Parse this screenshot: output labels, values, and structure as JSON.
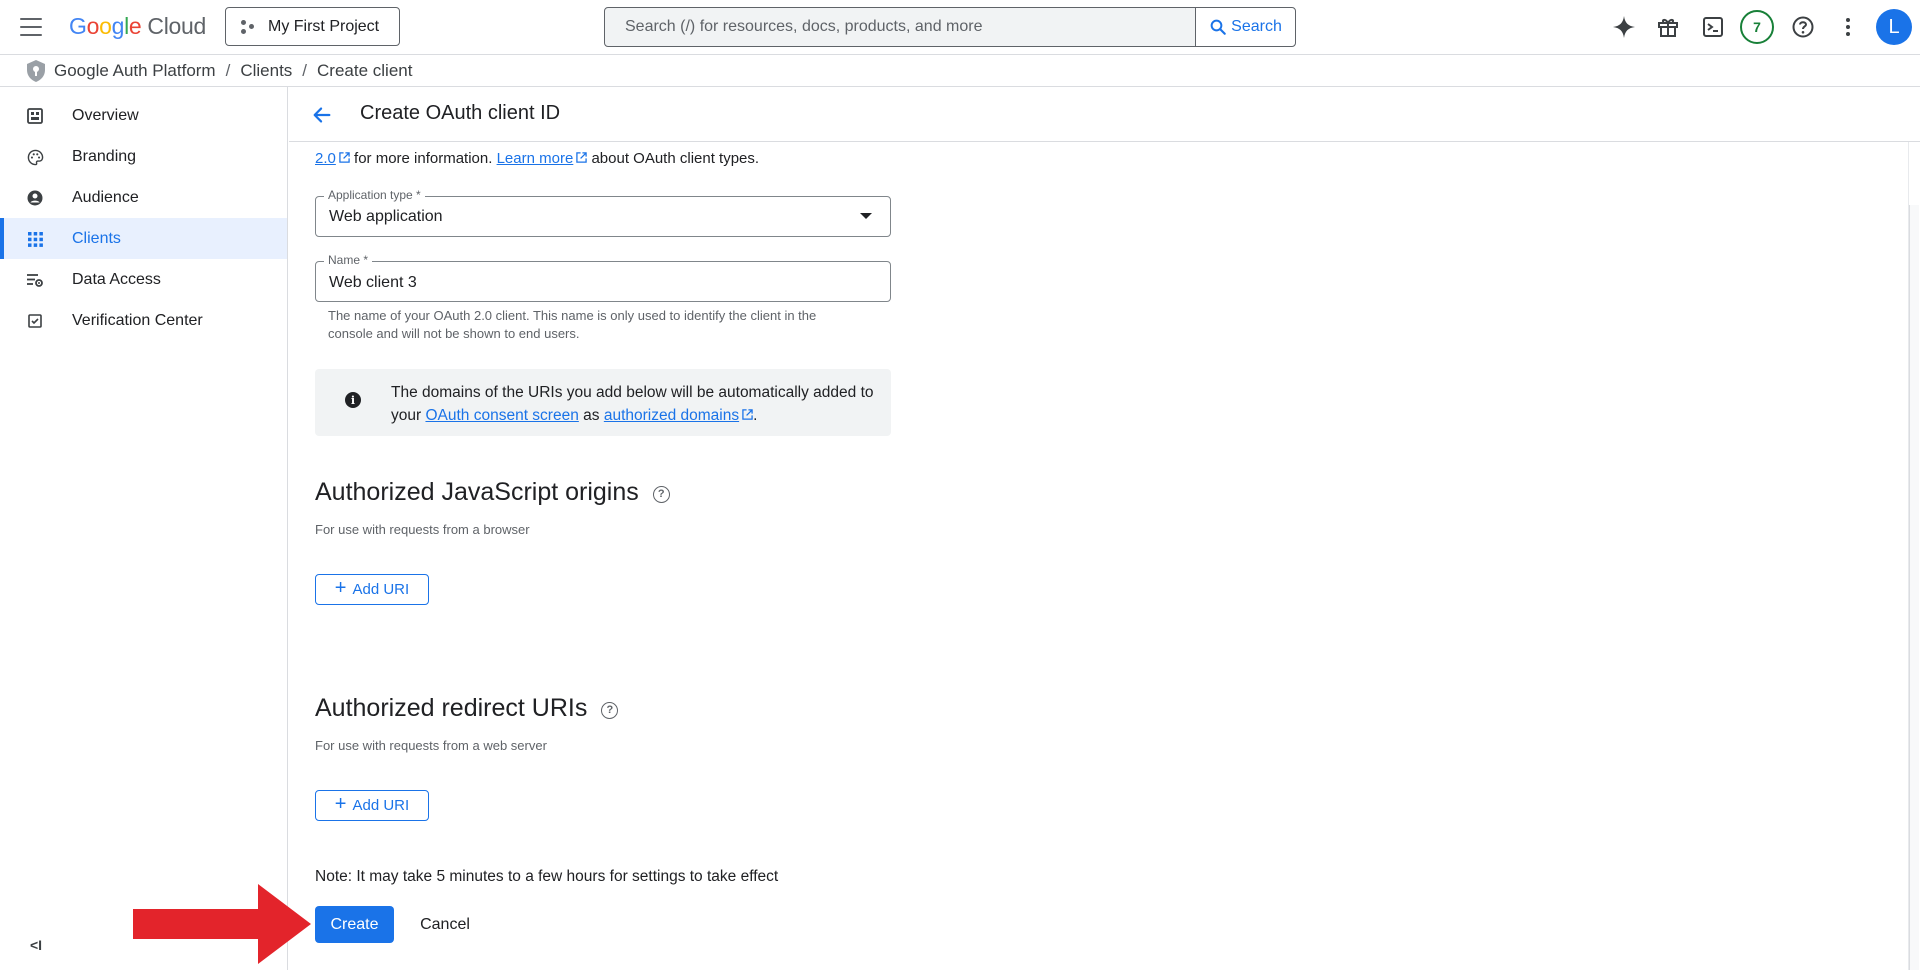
{
  "topbar": {
    "logo_letters": [
      "G",
      "o",
      "o",
      "g",
      "l",
      "e"
    ],
    "logo_cloud": "Cloud",
    "project_name": "My First Project",
    "search_placeholder": "Search (/) for resources, docs, products, and more",
    "search_button": "Search",
    "notifications_count": "7",
    "avatar_initial": "L"
  },
  "breadcrumb": {
    "items": [
      "Google Auth Platform",
      "Clients",
      "Create client"
    ],
    "separator": "/"
  },
  "sidebar": {
    "items": [
      {
        "label": "Overview",
        "icon": "dashboard-icon",
        "active": false
      },
      {
        "label": "Branding",
        "icon": "palette-icon",
        "active": false
      },
      {
        "label": "Audience",
        "icon": "person-icon",
        "active": false
      },
      {
        "label": "Clients",
        "icon": "grid-icon",
        "active": true
      },
      {
        "label": "Data Access",
        "icon": "filter-settings-icon",
        "active": false
      },
      {
        "label": "Verification Center",
        "icon": "checkbox-icon",
        "active": false
      }
    ],
    "collapse_label": "<I"
  },
  "header": {
    "title": "Create OAuth client ID"
  },
  "form": {
    "intro": {
      "link1": "2.0",
      "text1": " for more information. ",
      "link2": "Learn more",
      "text2": " about OAuth client types."
    },
    "application_type": {
      "label": "Application type *",
      "value": "Web application"
    },
    "name": {
      "label": "Name *",
      "value": "Web client 3",
      "hint": "The name of your OAuth 2.0 client. This name is only used to identify the client in the console and will not be shown to end users."
    },
    "info": {
      "text1": "The domains of the URIs you add below will be automatically added to your ",
      "link1": "OAuth consent screen",
      "text2": " as ",
      "link2": "authorized domains",
      "text3": "."
    },
    "js_origins": {
      "title": "Authorized JavaScript origins",
      "subtitle": "For use with requests from a browser",
      "add_label": "Add URI"
    },
    "redirect_uris": {
      "title": "Authorized redirect URIs",
      "subtitle": "For use with requests from a web server",
      "add_label": "Add URI"
    },
    "note": "Note: It may take 5 minutes to a few hours for settings to take effect",
    "create_label": "Create",
    "cancel_label": "Cancel"
  },
  "colors": {
    "primary": "#1a73e8",
    "annotation_arrow": "#e3242b",
    "active_nav_bg": "#e8f0fe",
    "badge_green": "#188038"
  }
}
